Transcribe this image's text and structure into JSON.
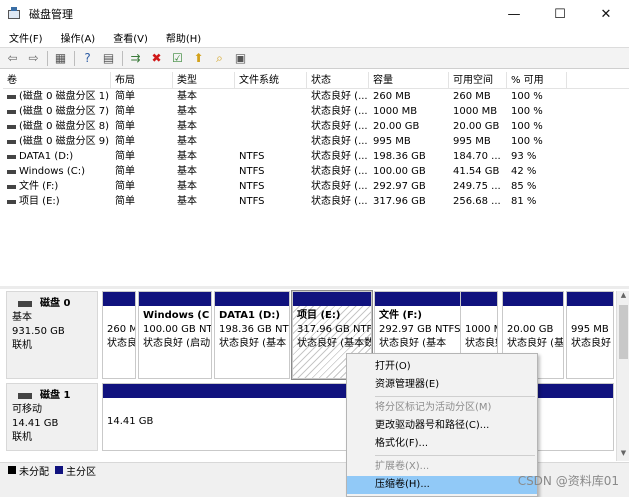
{
  "window": {
    "title": "磁盘管理",
    "minimize": "—",
    "maximize": "☐",
    "close": "✕"
  },
  "menu": [
    {
      "label": "文件(F)",
      "name": "menu-file"
    },
    {
      "label": "操作(A)",
      "name": "menu-action"
    },
    {
      "label": "查看(V)",
      "name": "menu-view"
    },
    {
      "label": "帮助(H)",
      "name": "menu-help"
    }
  ],
  "toolbar": [
    {
      "name": "back-arrow-icon",
      "glyph": "⇦",
      "color": "#6b6b6b"
    },
    {
      "name": "forward-arrow-icon",
      "glyph": "⇨",
      "color": "#6b6b6b"
    },
    {
      "name": "sep"
    },
    {
      "name": "console-tree-icon",
      "glyph": "▦",
      "color": "#555555"
    },
    {
      "name": "sep"
    },
    {
      "name": "help-icon",
      "glyph": "?",
      "color": "#2f5ea5"
    },
    {
      "name": "properties-icon",
      "glyph": "▤",
      "color": "#555555"
    },
    {
      "name": "sep"
    },
    {
      "name": "connect-disk-icon",
      "glyph": "⇉",
      "color": "#3a7a3a"
    },
    {
      "name": "delete-icon",
      "glyph": "✖",
      "color": "#d01818"
    },
    {
      "name": "check-icon",
      "glyph": "☑",
      "color": "#3b8a3b"
    },
    {
      "name": "folder-up-icon",
      "glyph": "⬆",
      "color": "#d3a21c"
    },
    {
      "name": "search-folder-icon",
      "glyph": "⌕",
      "color": "#d3a21c"
    },
    {
      "name": "settings-panel-icon",
      "glyph": "▣",
      "color": "#555555"
    }
  ],
  "table": {
    "columns": [
      "卷",
      "布局",
      "类型",
      "文件系统",
      "状态",
      "容量",
      "可用空间",
      "% 可用"
    ],
    "rows": [
      [
        "(磁盘 0 磁盘分区 1)",
        "简单",
        "基本",
        "",
        "状态良好 (...",
        "260 MB",
        "260 MB",
        "100 %"
      ],
      [
        "(磁盘 0 磁盘分区 7)",
        "简单",
        "基本",
        "",
        "状态良好 (...",
        "1000 MB",
        "1000 MB",
        "100 %"
      ],
      [
        "(磁盘 0 磁盘分区 8)",
        "简单",
        "基本",
        "",
        "状态良好 (...",
        "20.00 GB",
        "20.00 GB",
        "100 %"
      ],
      [
        "(磁盘 0 磁盘分区 9)",
        "简单",
        "基本",
        "",
        "状态良好 (...",
        "995 MB",
        "995 MB",
        "100 %"
      ],
      [
        "DATA1 (D:)",
        "简单",
        "基本",
        "NTFS",
        "状态良好 (...",
        "198.36 GB",
        "184.70 ...",
        "93 %"
      ],
      [
        "Windows (C:)",
        "简单",
        "基本",
        "NTFS",
        "状态良好 (...",
        "100.00 GB",
        "41.54 GB",
        "42 %"
      ],
      [
        "文件 (F:)",
        "简单",
        "基本",
        "NTFS",
        "状态良好 (...",
        "292.97 GB",
        "249.75 ...",
        "85 %"
      ],
      [
        "项目 (E:)",
        "简单",
        "基本",
        "NTFS",
        "状态良好 (...",
        "317.96 GB",
        "256.68 ...",
        "81 %"
      ]
    ]
  },
  "disk0": {
    "name": "磁盘 0",
    "type": "基本",
    "size": "931.50 GB",
    "status": "联机",
    "partitions": [
      {
        "name": "",
        "size": "260 MB",
        "status": "状态良好"
      },
      {
        "name": "Windows (C",
        "size": "100.00 GB NTFS",
        "status": "状态良好 (启动"
      },
      {
        "name": "DATA1 (D:)",
        "size": "198.36 GB NTFS",
        "status": "状态良好 (基本"
      },
      {
        "name": "项目 (E:)",
        "size": "317.96 GB NTFS",
        "status": "状态良好 (基本数"
      },
      {
        "name": "文件 (F:)",
        "size": "292.97 GB NTFS",
        "status": "状态良好 (基本"
      },
      {
        "name": "",
        "size": "1000 MB",
        "status": "状态良好"
      },
      {
        "name": "",
        "size": "20.00 GB",
        "status": "状态良好 (基"
      },
      {
        "name": "",
        "size": "995 MB",
        "status": "状态良好"
      }
    ]
  },
  "disk1": {
    "name": "磁盘 1",
    "type": "可移动",
    "size": "14.41 GB",
    "status": "联机",
    "partition_size": "14.41 GB"
  },
  "legend": [
    {
      "label": "未分配",
      "color": "#000000"
    },
    {
      "label": "主分区",
      "color": "#10127e"
    }
  ],
  "context_menu": [
    {
      "label": "打开(O)",
      "disabled": false,
      "name": "ctx-open"
    },
    {
      "label": "资源管理器(E)",
      "disabled": false,
      "name": "ctx-explorer"
    },
    {
      "sep": true
    },
    {
      "label": "将分区标记为活动分区(M)",
      "disabled": true,
      "name": "ctx-mark-active"
    },
    {
      "label": "更改驱动器号和路径(C)...",
      "disabled": false,
      "name": "ctx-change-letter"
    },
    {
      "label": "格式化(F)...",
      "disabled": false,
      "name": "ctx-format"
    },
    {
      "sep": true
    },
    {
      "label": "扩展卷(X)...",
      "disabled": true,
      "name": "ctx-extend"
    },
    {
      "label": "压缩卷(H)...",
      "disabled": false,
      "hover": true,
      "name": "ctx-shrink"
    }
  ],
  "watermark": "CSDN @资料库01"
}
